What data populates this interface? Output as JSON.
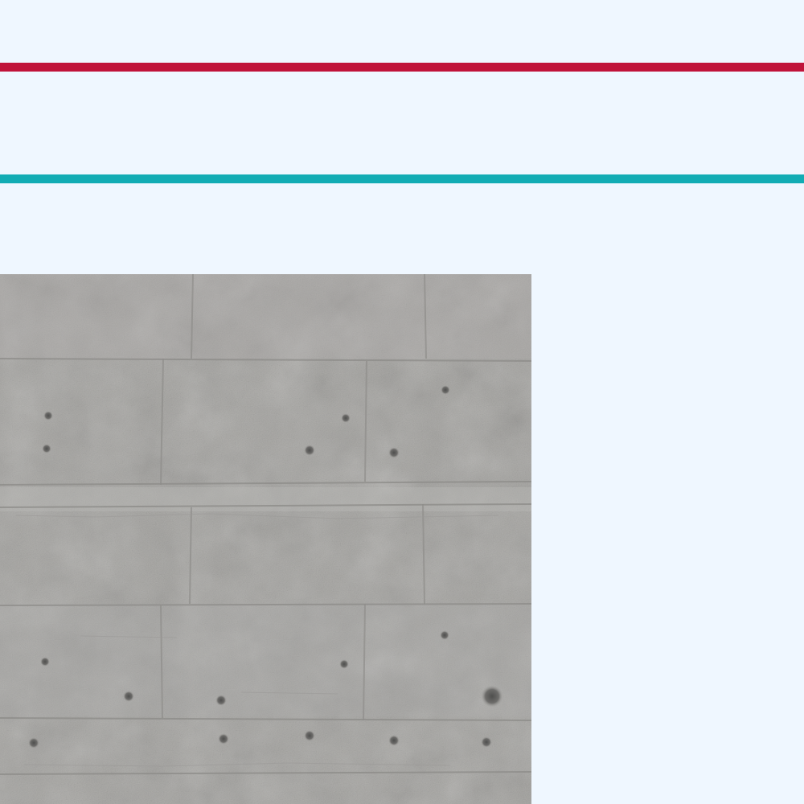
{
  "page": {
    "background_color": "#eff7ff"
  },
  "stripes": [
    {
      "name": "top-stripe",
      "color": "#c0133a"
    },
    {
      "name": "bottom-stripe",
      "color": "#12acb4"
    }
  ],
  "image": {
    "subject": "concrete-wall-texture",
    "base_color": "#a9a8a5"
  }
}
